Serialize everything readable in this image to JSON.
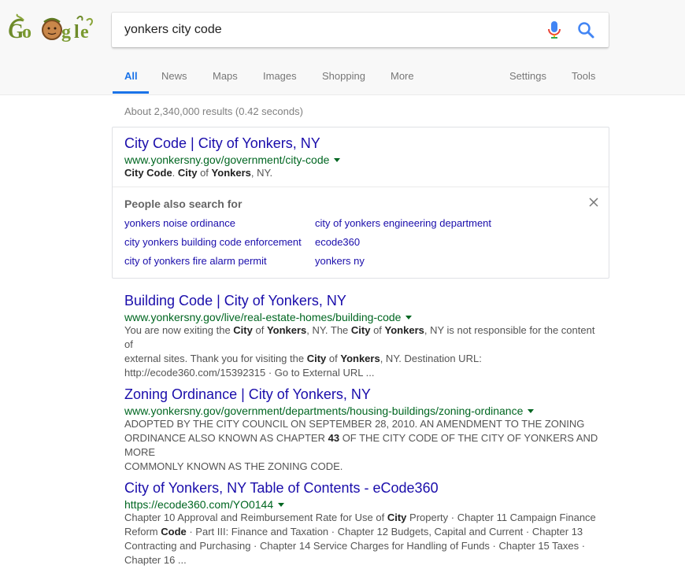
{
  "search": {
    "query": "yonkers city code"
  },
  "tabs": {
    "left": [
      "All",
      "News",
      "Maps",
      "Images",
      "Shopping",
      "More"
    ],
    "right": [
      "Settings",
      "Tools"
    ]
  },
  "result_stats": "About 2,340,000 results (0.42 seconds)",
  "featured": {
    "title": "City Code | City of Yonkers, NY",
    "url": "www.yonkersny.gov/government/city-code",
    "snippet_parts": [
      {
        "t": "City Code",
        "b": true
      },
      {
        "t": ". ",
        "b": false
      },
      {
        "t": "City",
        "b": true
      },
      {
        "t": " of ",
        "b": false
      },
      {
        "t": "Yonkers",
        "b": true
      },
      {
        "t": ", NY.",
        "b": false
      }
    ]
  },
  "people_also_search": {
    "title": "People also search for",
    "links": [
      "yonkers noise ordinance",
      "city of yonkers engineering department",
      "city yonkers building code enforcement",
      "ecode360",
      "city of yonkers fire alarm permit",
      "yonkers ny"
    ]
  },
  "results": [
    {
      "title": "Building Code | City of Yonkers, NY",
      "url": "www.yonkersny.gov/live/real-estate-homes/building-code",
      "snippet_lines": [
        [
          {
            "t": "You are now exiting the ",
            "b": false
          },
          {
            "t": "City",
            "b": true
          },
          {
            "t": " of ",
            "b": false
          },
          {
            "t": "Yonkers",
            "b": true
          },
          {
            "t": ", NY. The ",
            "b": false
          },
          {
            "t": "City",
            "b": true
          },
          {
            "t": " of ",
            "b": false
          },
          {
            "t": "Yonkers",
            "b": true
          },
          {
            "t": ", NY is not responsible for the content of",
            "b": false
          }
        ],
        [
          {
            "t": "external sites. Thank you for visiting the ",
            "b": false
          },
          {
            "t": "City",
            "b": true
          },
          {
            "t": " of ",
            "b": false
          },
          {
            "t": "Yonkers",
            "b": true
          },
          {
            "t": ", NY. Destination URL:",
            "b": false
          }
        ],
        [
          {
            "t": "http://ecode360.com/15392315 · Go to External URL ...",
            "b": false
          }
        ]
      ]
    },
    {
      "title": "Zoning Ordinance | City of Yonkers, NY",
      "url": "www.yonkersny.gov/government/departments/housing-buildings/zoning-ordinance",
      "snippet_lines": [
        [
          {
            "t": "ADOPTED BY THE CITY COUNCIL ON SEPTEMBER 28, 2010. AN AMENDMENT TO THE ZONING",
            "b": false
          }
        ],
        [
          {
            "t": "ORDINANCE ALSO KNOWN AS CHAPTER ",
            "b": false
          },
          {
            "t": "43",
            "b": true
          },
          {
            "t": " OF THE CITY CODE OF THE CITY OF YONKERS AND MORE",
            "b": false
          }
        ],
        [
          {
            "t": "COMMONLY KNOWN AS THE ZONING CODE.",
            "b": false
          }
        ]
      ]
    },
    {
      "title": "City of Yonkers, NY Table of Contents - eCode360",
      "url": "https://ecode360.com/YO0144",
      "snippet_lines": [
        [
          {
            "t": "Chapter 10 Approval and Reimbursement Rate for Use of ",
            "b": false
          },
          {
            "t": "City",
            "b": true
          },
          {
            "t": " Property · Chapter 11 Campaign Finance",
            "b": false
          }
        ],
        [
          {
            "t": "Reform ",
            "b": false
          },
          {
            "t": "Code",
            "b": true
          },
          {
            "t": " · Part III: Finance and Taxation · Chapter 12 Budgets, Capital and Current · Chapter 13",
            "b": false
          }
        ],
        [
          {
            "t": "Contracting and Purchasing · Chapter 14 Service Charges for Handling of Funds · Chapter 15 Taxes ·",
            "b": false
          }
        ],
        [
          {
            "t": "Chapter 16 ...",
            "b": false
          }
        ]
      ]
    }
  ]
}
